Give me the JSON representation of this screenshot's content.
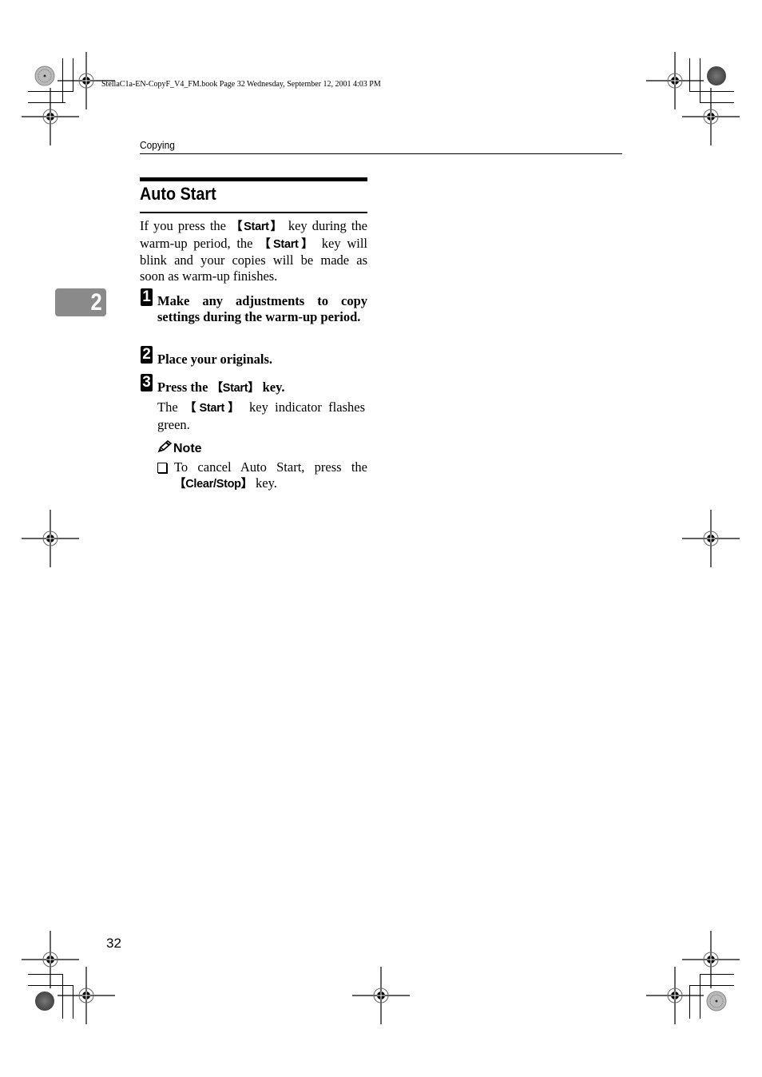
{
  "file_header": "StellaC1a-EN-CopyF_V4_FM.book  Page 32  Wednesday, September 12, 2001  4:03 PM",
  "running_header": "Copying",
  "chapter_tab": "2",
  "section": {
    "title": "Auto Start",
    "intro": {
      "part1": "If you press the ",
      "key1": "Start",
      "part2": " key during the warm-up period, the ",
      "key2": "Start",
      "part3": " key will blink and your copies will be made as soon as warm-up finishes."
    },
    "steps": [
      {
        "number": "1",
        "text": "Make any adjustments to copy settings during the warm-up period."
      },
      {
        "number": "2",
        "text": "Place your originals."
      },
      {
        "number": "3",
        "text_before": "Press the ",
        "key": "Start",
        "text_after": " key.",
        "detail_before": "The ",
        "detail_key": "Start",
        "detail_after": " key indicator flashes green."
      }
    ],
    "note": {
      "label": "Note",
      "items": [
        {
          "text_before": "To cancel Auto Start, press the ",
          "key": "Clear/Stop",
          "text_after": " key."
        }
      ]
    }
  },
  "page_number": "32",
  "brackets": {
    "open": "【",
    "close": "】"
  }
}
